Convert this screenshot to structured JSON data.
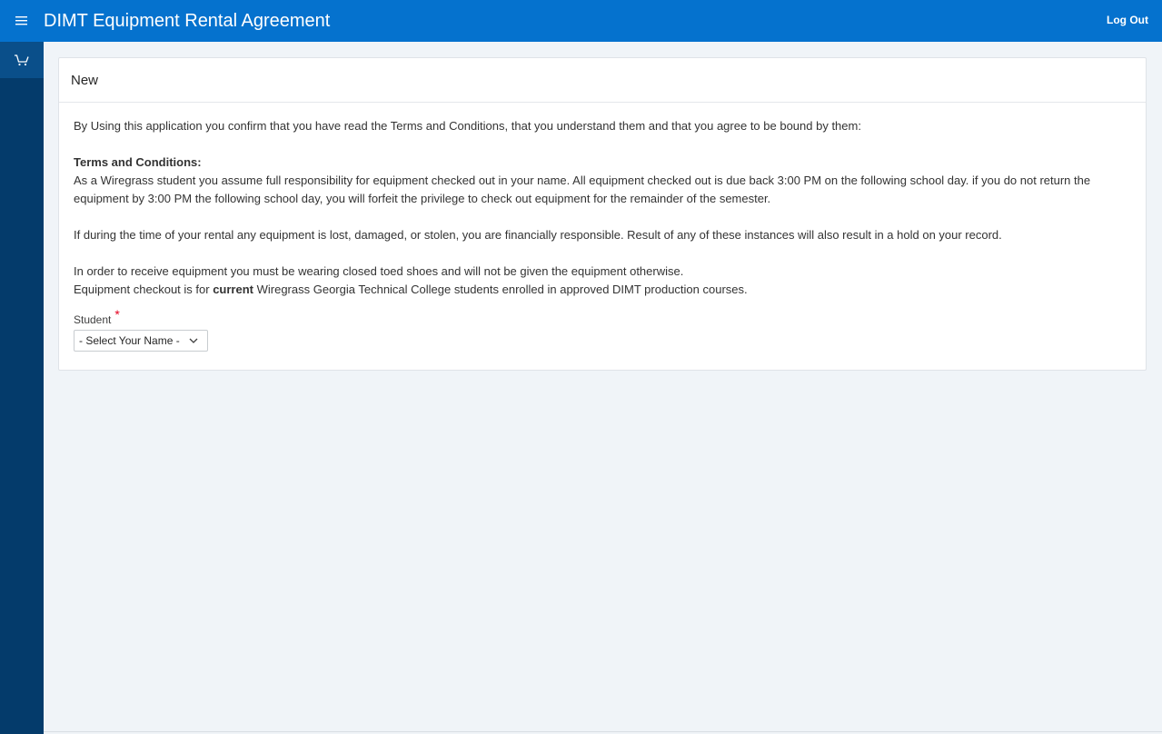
{
  "header": {
    "title": "DIMT Equipment Rental Agreement",
    "logout_label": "Log Out",
    "menu_icon": "hamburger-icon"
  },
  "sidebar": {
    "items": [
      {
        "icon": "cart-icon"
      }
    ]
  },
  "region": {
    "title": "New",
    "intro": "By Using this application you confirm that you have read the Terms and Conditions, that you understand them and that you agree to be bound by them:",
    "terms_heading": "Terms and Conditions:",
    "terms_text": "As a Wiregrass student you assume full responsibility for equipment checked out in your name. All equipment checked out is due back 3:00 PM on the following school day. if you do not return the equipment by 3:00 PM the following school day, you will forfeit the privilege to check out equipment for the remainder of the semester.",
    "liability_text": "If during the time of your rental any equipment is lost, damaged, or stolen, you are financially responsible. Result of any of these instances will also result in a hold on your record.",
    "shoes_text": "In order to receive equipment you must be wearing closed toed shoes and will not be given the equipment otherwise.",
    "eligibility_prefix": "Equipment checkout is for ",
    "eligibility_bold": "current",
    "eligibility_suffix": " Wiregrass Georgia Technical College students enrolled in approved DIMT production courses."
  },
  "form": {
    "student_label": "Student",
    "required_mark": "*",
    "student_select_value": "- Select Your Name -"
  },
  "colors": {
    "header_bg": "#0572ce",
    "sidebar_bg": "#043b6b",
    "required": "#e5001f"
  }
}
